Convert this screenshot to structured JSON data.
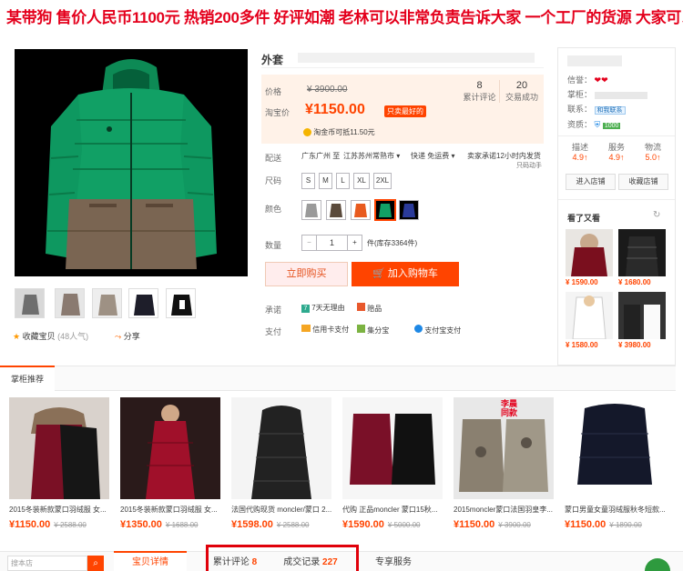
{
  "banner": {
    "text": "某带狗 售价人民币1100元 热销200多件 好评如潮 老林可以非常负责告诉大家 一个工厂的货源 大家可以放心"
  },
  "product": {
    "title": "外套",
    "price_label": "价格",
    "original_price": "¥ 3900.00",
    "taobao_label": "淘宝价",
    "price": "¥1150.00",
    "price_tag": "只卖最好的",
    "coin_text": "淘金币可抵11.50元",
    "reviews_count": "8",
    "reviews_label": "累计评论",
    "sales_count": "20",
    "sales_label": "交易成功",
    "shipping_label": "配送",
    "shipping_from": "广东广州 至",
    "shipping_to": "江苏苏州常熟市",
    "shipping_method": "快递 免运费",
    "shipping_promise": "卖家承诺12小时内发货",
    "shipping_promise_sub": "只码动手",
    "size_label": "尺码",
    "sizes": [
      "S",
      "M",
      "L",
      "XL",
      "2XL"
    ],
    "color_label": "颜色",
    "quantity_label": "数量",
    "quantity": "1",
    "quantity_minus": "−",
    "quantity_plus": "+",
    "stock_text": "件(库存3364件)",
    "buy_now": "立即购买",
    "add_cart": "加入购物车",
    "promise_label": "承诺",
    "promise_7days": "7天无理由",
    "promise_tuihuo": "退货",
    "promise_extra": "赔品",
    "pay_label": "支付",
    "pay_credit": "信用卡支付",
    "pay_jifen": "集分宝",
    "pay_alipay": "支付宝支付",
    "favorite": "收藏宝贝",
    "favorite_count": "(48人气)",
    "share": "分享"
  },
  "seller": {
    "credit_label": "信誉：",
    "shopkeeper_label": "掌柜：",
    "contact_label": "联系：",
    "contact_tag": "和我联系",
    "qual_label": "资质：",
    "qual_tag": "1000",
    "scores": [
      {
        "label": "描述",
        "value": "4.9"
      },
      {
        "label": "服务",
        "value": "4.9"
      },
      {
        "label": "物流",
        "value": "5.0"
      }
    ],
    "enter_shop": "进入店铺",
    "fav_shop": "收藏店铺",
    "see_also": "看了又看",
    "refresh_icon": "↻",
    "see_prices": [
      "¥ 1590.00",
      "¥ 1680.00",
      "¥ 1580.00",
      "¥ 3980.00"
    ]
  },
  "recommend": {
    "tab": "掌柜推荐",
    "items": [
      {
        "name": "2015冬装新款蒙口羽绒服 女...",
        "price": "¥1150.00",
        "old": "¥ 2588.00"
      },
      {
        "name": "2015冬装新款蒙口羽绒服 女...",
        "price": "¥1350.00",
        "old": "¥ 1688.00"
      },
      {
        "name": "法国代购现货 moncler/蒙口 2...",
        "price": "¥1598.00",
        "old": "¥ 2588.00"
      },
      {
        "name": "代购 正品moncler 蒙口15秋...",
        "price": "¥1590.00",
        "old": "¥ 5000.00"
      },
      {
        "name": "2015moncler蒙口法国羽皇李...",
        "price": "¥1150.00",
        "old": "¥ 3900.00"
      },
      {
        "name": "蒙口男童女童羽绒服秋冬短款...",
        "price": "¥1150.00",
        "old": "¥ 1890.00"
      }
    ],
    "overlay_label": "李晨同款"
  },
  "bottom": {
    "search_placeholder": "搜本店",
    "tab_details": "宝贝详情",
    "tab_reviews": "累计评论",
    "tab_reviews_count": "8",
    "tab_records": "成交记录",
    "tab_records_count": "227",
    "tab_service": "专享服务"
  },
  "colors": {
    "accent": "#ff4400",
    "banner_red": "#e4001c",
    "highlight": "#e0000a"
  }
}
